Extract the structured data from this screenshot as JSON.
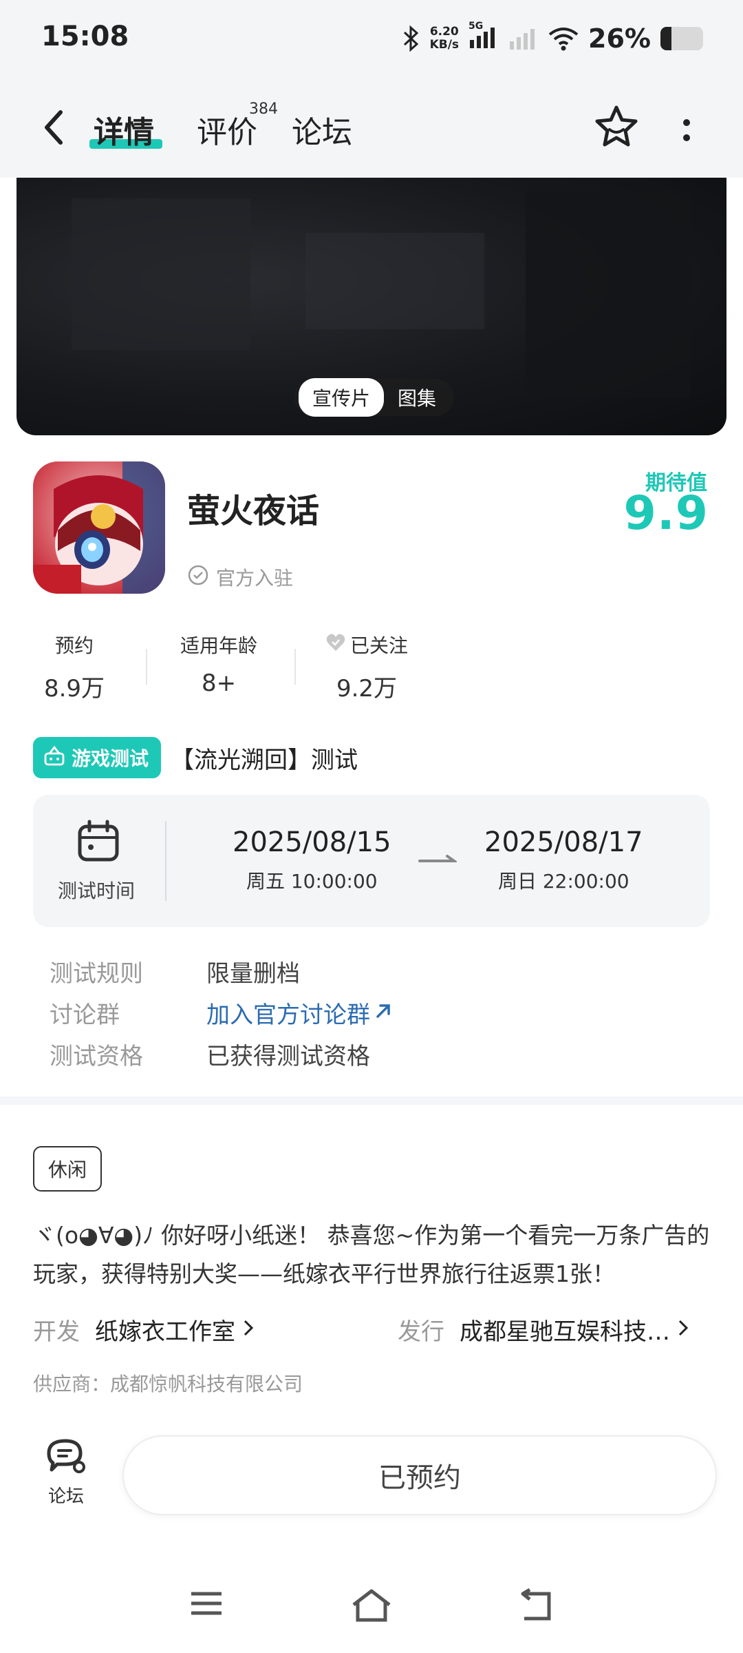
{
  "status_bar": {
    "time": "15:08",
    "net_speed_value": "6.20",
    "net_speed_unit": "KB/s",
    "network_type": "5G",
    "battery_percent": "26%",
    "battery_level": 0.26
  },
  "nav": {
    "tabs": [
      {
        "label": "详情",
        "active": true
      },
      {
        "label": "评价",
        "count": "384"
      },
      {
        "label": "论坛"
      }
    ]
  },
  "banner": {
    "pills": [
      "宣传片",
      "图集"
    ]
  },
  "app": {
    "title": "萤火夜话",
    "official_label": "官方入驻",
    "expect_label": "期待值",
    "expect_value": "9.9"
  },
  "stats": [
    {
      "label": "预约",
      "value": "8.9万"
    },
    {
      "label": "适用年龄",
      "value": "8+"
    },
    {
      "label": "已关注",
      "value": "9.2万"
    }
  ],
  "test": {
    "badge": "游戏测试",
    "name": "【流光溯回】测试",
    "time_label": "测试时间",
    "start_date": "2025/08/15",
    "start_sub": "周五  10:00:00",
    "end_date": "2025/08/17",
    "end_sub": "周日  22:00:00"
  },
  "info": [
    {
      "key": "测试规则",
      "value": "限量删档"
    },
    {
      "key": "讨论群",
      "value": "加入官方讨论群"
    },
    {
      "key": "测试资格",
      "value": "已获得测试资格"
    }
  ],
  "tag": "休闲",
  "description": "ヾ(o◕∀◕)ﾉ 你好呀小纸迷！ 恭喜您~作为第一个看完一万条广告的玩家，获得特别大奖——纸嫁衣平行世界旅行往返票1张！",
  "developer": {
    "key": "开发",
    "value": "纸嫁衣工作室"
  },
  "publisher": {
    "key": "发行",
    "value": "成都星驰互娱科技…"
  },
  "supplier": "供应商：成都惊帆科技有限公司",
  "bottom": {
    "forum_label": "论坛",
    "reserve_label": "已预约"
  },
  "colors": {
    "accent": "#1ec8b6",
    "link": "#2b6cb0"
  }
}
